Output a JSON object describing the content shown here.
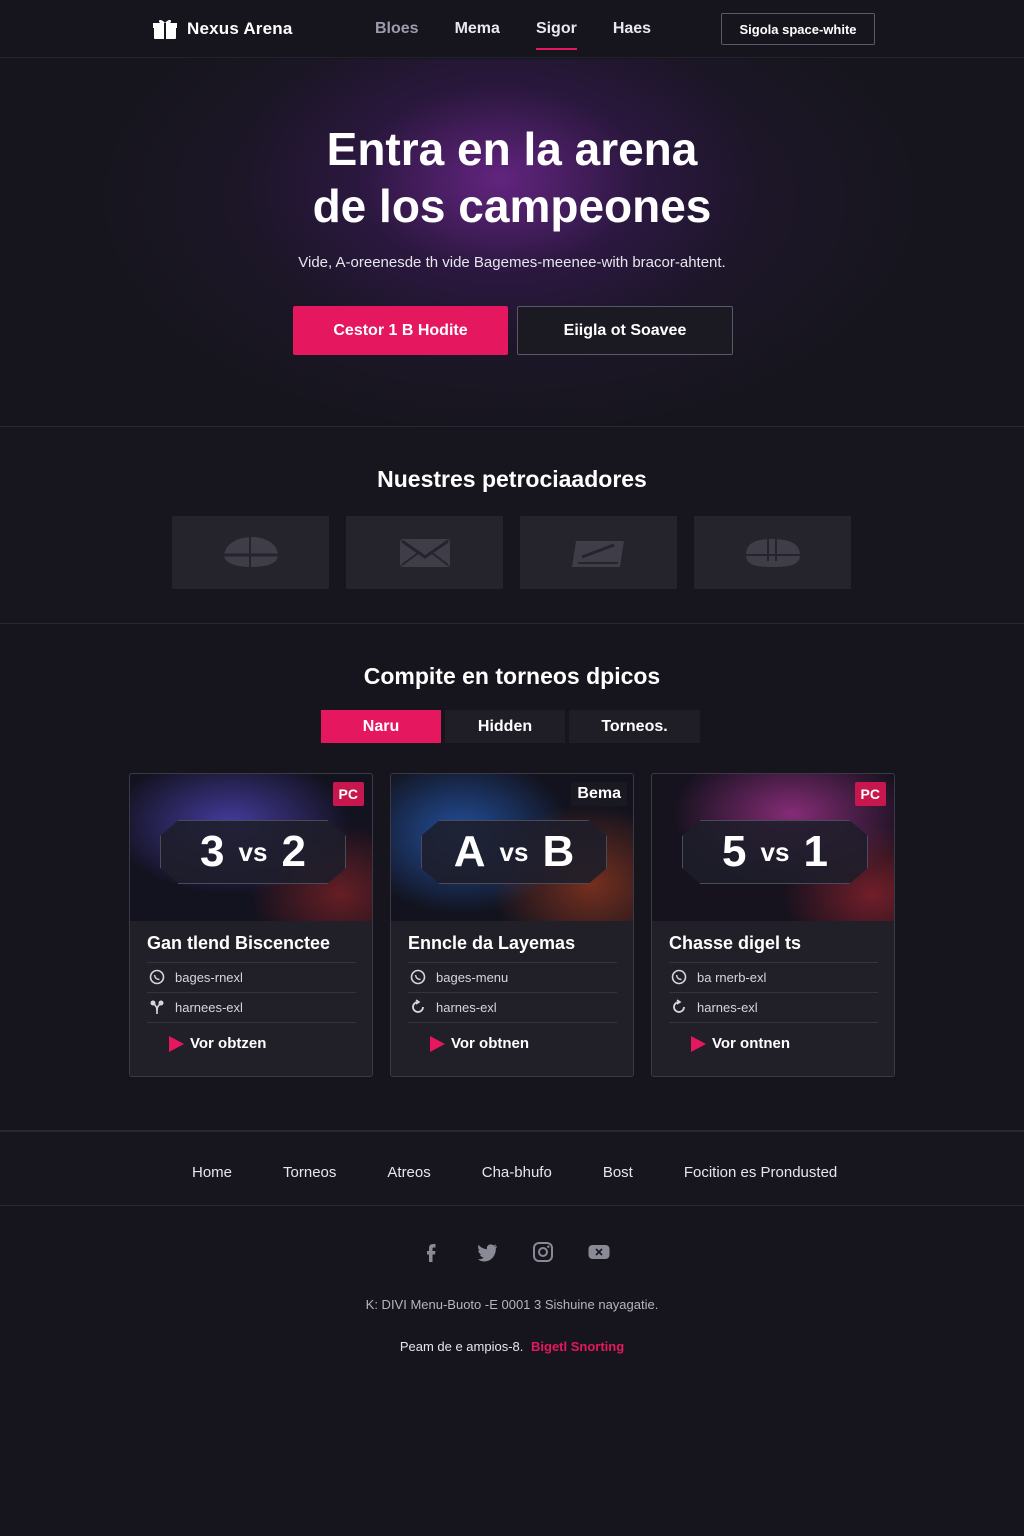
{
  "brand": {
    "name": "Nexus Arena",
    "icon": "gift-box-icon"
  },
  "nav": {
    "links": [
      {
        "label": "Bloes",
        "state": "muted"
      },
      {
        "label": "Mema",
        "state": "normal"
      },
      {
        "label": "Sigor",
        "state": "active"
      },
      {
        "label": "Haes",
        "state": "normal"
      }
    ],
    "cta": "Sigola space-white"
  },
  "hero": {
    "title_line1": "Entra en la arena",
    "title_line2": "de los campeones",
    "subtitle": "Vide, A-oreenesde th vide Bagemes-meenee-with bracor-ahtent.",
    "primary_button": "Cestor 1 B Hodite",
    "secondary_button": "Eiigla ot Soavee"
  },
  "sponsors": {
    "title": "Nuestres petrociaadores",
    "logos": [
      "helmet-logo-icon",
      "envelope-logo-icon",
      "card-logo-icon",
      "gamepad-logo-icon"
    ]
  },
  "tournaments": {
    "title": "Compite en torneos dpicos",
    "tabs": [
      {
        "label": "Naru",
        "active": true
      },
      {
        "label": "Hidden",
        "active": false
      },
      {
        "label": "Torneos.",
        "active": false
      }
    ],
    "cards": [
      {
        "left": "3",
        "vs": "vs",
        "right": "2",
        "badge": "PC",
        "title": "Gan tlend Biscenctee",
        "meta1": "bages-rnexl",
        "meta2": "harnees-exl",
        "link": "Vor obtzen"
      },
      {
        "left": "A",
        "vs": "vs",
        "right": "B",
        "badge": "Bema",
        "title": "Enncle da Layemas",
        "meta1": "bages-menu",
        "meta2": "harnes-exl",
        "link": "Vor obtnen"
      },
      {
        "left": "5",
        "vs": "vs",
        "right": "1",
        "badge": "PC",
        "title": "Chasse digel ts",
        "meta1": "ba rnerb-exl",
        "meta2": "harnes-exl",
        "link": "Vor ontnen"
      }
    ]
  },
  "footer": {
    "links": [
      "Home",
      "Torneos",
      "Atreos",
      "Cha-bhufo",
      "Bost",
      "Focition es Prondusted"
    ],
    "socials": [
      "facebook-icon",
      "twitter-icon",
      "instagram-icon",
      "youtube-icon"
    ],
    "legal": "K: DIVI Menu-Buoto -E 0001 3 Sishuine nayagatie.",
    "copyright": "Peam de e ampios-8.",
    "copyright_accent": "Bigetl Snorting"
  },
  "colors": {
    "accent": "#e5175f",
    "background": "#16151d",
    "card": "#211f28"
  }
}
